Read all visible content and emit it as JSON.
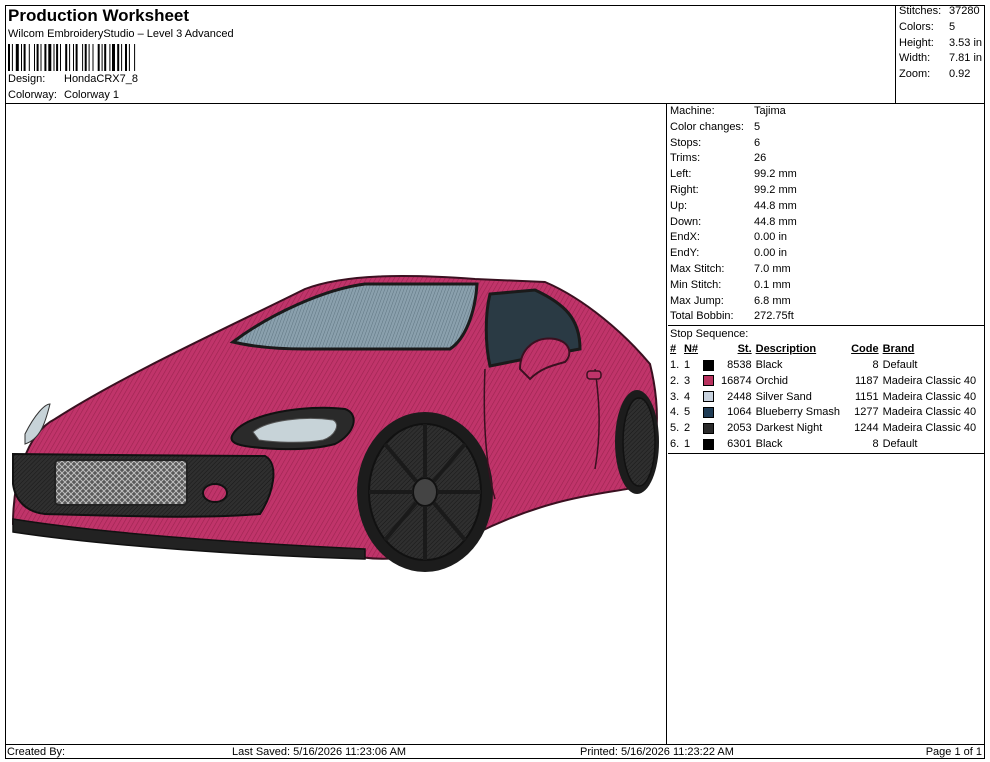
{
  "header": {
    "title": "Production Worksheet",
    "subtitle": "Wilcom EmbroideryStudio – Level 3 Advanced",
    "design_label": "Design:",
    "design_value": "HondaCRX7_8",
    "colorway_label": "Colorway:",
    "colorway_value": "Colorway 1"
  },
  "stats": {
    "stitches_label": "Stitches:",
    "stitches": "37280",
    "colors_label": "Colors:",
    "colors": "5",
    "height_label": "Height:",
    "height": "3.53 in",
    "width_label": "Width:",
    "width": "7.81 in",
    "zoom_label": "Zoom:",
    "zoom": "0.92"
  },
  "machine_info": [
    {
      "label": "Machine:",
      "value": "Tajima"
    },
    {
      "label": "Color changes:",
      "value": "5"
    },
    {
      "label": "Stops:",
      "value": "6"
    },
    {
      "label": "Trims:",
      "value": "26"
    },
    {
      "label": "Left:",
      "value": "99.2 mm"
    },
    {
      "label": "Right:",
      "value": "99.2 mm"
    },
    {
      "label": "Up:",
      "value": "44.8 mm"
    },
    {
      "label": "Down:",
      "value": "44.8 mm"
    },
    {
      "label": "EndX:",
      "value": "0.00 in"
    },
    {
      "label": "EndY:",
      "value": "0.00 in"
    },
    {
      "label": "Max Stitch:",
      "value": "7.0 mm"
    },
    {
      "label": "Min Stitch:",
      "value": "0.1 mm"
    },
    {
      "label": "Max Jump:",
      "value": "6.8 mm"
    },
    {
      "label": "Total Bobbin:",
      "value": "272.75ft"
    }
  ],
  "stop_sequence": {
    "title": "Stop Sequence:",
    "headers": {
      "num": "#",
      "n": "N#",
      "st": "St.",
      "desc": "Description",
      "code": "Code",
      "brand": "Brand"
    },
    "rows": [
      {
        "num": "1.",
        "n": "1",
        "color": "#000000",
        "st": "8538",
        "desc": "Black",
        "code": "8",
        "brand": "Default"
      },
      {
        "num": "2.",
        "n": "3",
        "color": "#b8325e",
        "st": "16874",
        "desc": "Orchid",
        "code": "1187",
        "brand": "Madeira Classic 40"
      },
      {
        "num": "3.",
        "n": "4",
        "color": "#c8d2de",
        "st": "2448",
        "desc": "Silver Sand",
        "code": "1151",
        "brand": "Madeira Classic 40"
      },
      {
        "num": "4.",
        "n": "5",
        "color": "#1f3c55",
        "st": "1064",
        "desc": "Blueberry Smash",
        "code": "1277",
        "brand": "Madeira Classic 40"
      },
      {
        "num": "5.",
        "n": "2",
        "color": "#2a2a2a",
        "st": "2053",
        "desc": "Darkest Night",
        "code": "1244",
        "brand": "Madeira Classic 40"
      },
      {
        "num": "6.",
        "n": "1",
        "color": "#000000",
        "st": "6301",
        "desc": "Black",
        "code": "8",
        "brand": "Default"
      }
    ]
  },
  "footer": {
    "created": "Created By:",
    "saved": "Last Saved: 5/16/2026 11:23:06 AM",
    "printed": "Printed: 5/16/2026 11:23:22 AM",
    "page": "Page 1 of 1"
  }
}
